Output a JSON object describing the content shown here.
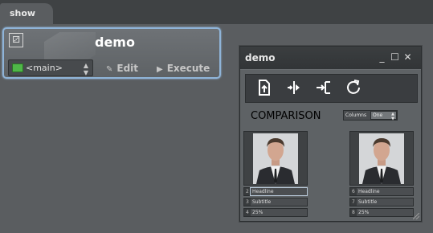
{
  "tab": {
    "label": "show"
  },
  "node": {
    "title": "demo",
    "select_value": "<main>",
    "edit_label": "Edit",
    "execute_label": "Execute"
  },
  "panel": {
    "title": "demo",
    "window_controls": {
      "minimize": "_",
      "maximize": "☐",
      "close": "✕"
    },
    "toolbar_icons": [
      "upload-page-icon",
      "split-horizontal-icon",
      "import-bracket-icon",
      "refresh-icon"
    ],
    "comparison_label": "COMPARISON",
    "columns_label": "Columns",
    "columns_value": "One",
    "cards": [
      {
        "rows": [
          {
            "num": "2",
            "value": "Headline"
          },
          {
            "num": "3",
            "value": "Subtitle"
          },
          {
            "num": "4",
            "value": "25%"
          }
        ]
      },
      {
        "rows": [
          {
            "num": "6",
            "value": "Headline"
          },
          {
            "num": "7",
            "value": "Subtitle"
          },
          {
            "num": "8",
            "value": "25%"
          }
        ]
      }
    ]
  },
  "colors": {
    "accent": "#8fb4d8",
    "background": "#5a5d60",
    "monitor": "#4fb748"
  }
}
